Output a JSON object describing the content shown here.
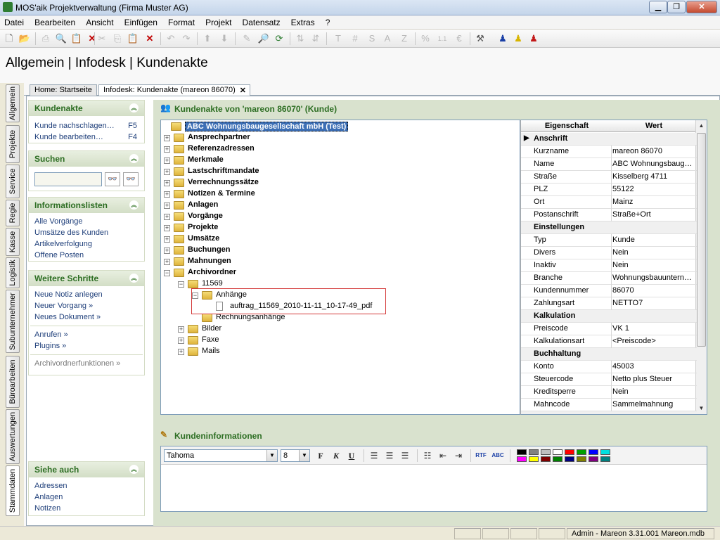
{
  "window": {
    "title": "MOS'aik Projektverwaltung (Firma Muster AG)",
    "btn_min": "▁",
    "btn_max": "❐",
    "btn_close": "✕"
  },
  "menu": [
    "Datei",
    "Bearbeiten",
    "Ansicht",
    "Einfügen",
    "Format",
    "Projekt",
    "Datensatz",
    "Extras",
    "?"
  ],
  "page_title": "Allgemein | Infodesk | Kundenakte",
  "side_tabs": [
    "Allgemein",
    "Projekte",
    "Service",
    "Regie",
    "Kasse",
    "Logistik",
    "Subunternehmer",
    "Büroarbeiten",
    "Auswertungen",
    "Stammdaten"
  ],
  "doc_tabs": [
    "Home: Startseite",
    "Infodesk: Kundenakte (mareon 86070)"
  ],
  "tab_close": "✕",
  "left": {
    "kundenakte": {
      "title": "Kundenakte",
      "links": [
        {
          "label": "Kunde nachschlagen…",
          "key": "F5"
        },
        {
          "label": "Kunde bearbeiten…",
          "key": "F4"
        }
      ]
    },
    "suchen": {
      "title": "Suchen",
      "value": ""
    },
    "infolisten": {
      "title": "Informationslisten",
      "links": [
        "Alle Vorgänge",
        "Umsätze des Kunden",
        "Artikelverfolgung",
        "Offene Posten"
      ]
    },
    "weitere": {
      "title": "Weitere Schritte",
      "links1": [
        "Neue Notiz anlegen",
        "Neuer Vorgang »",
        "Neues Dokument »"
      ],
      "links2": [
        "Anrufen »",
        "Plugins »"
      ],
      "links3": [
        "Archivordnerfunktionen »"
      ]
    },
    "siehe": {
      "title": "Siehe auch",
      "links": [
        "Adressen",
        "Anlagen",
        "Notizen"
      ]
    }
  },
  "kundenakte_header": "Kundenakte von 'mareon 86070' (Kunde)",
  "tree": {
    "root": "ABC Wohnungsbaugesellschaft mbH (Test)",
    "folders": [
      "Ansprechpartner",
      "Referenzadressen",
      "Merkmale",
      "Lastschriftmandate",
      "Verrechnungssätze",
      "Notizen & Termine",
      "Anlagen",
      "Vorgänge",
      "Projekte",
      "Umsätze",
      "Buchungen",
      "Mahnungen",
      "Archivordner"
    ],
    "archiv": {
      "sub": "11569",
      "anhaenge": "Anhänge",
      "file": "auftrag_11569_2010-11-11_10-17-49_pdf",
      "rechnung": "Rechnungsanhänge"
    },
    "others": [
      "Bilder",
      "Faxe",
      "Mails"
    ]
  },
  "grid": {
    "col_prop": "Eigenschaft",
    "col_val": "Wert",
    "rows": [
      {
        "cat": "Anschrift"
      },
      {
        "k": "Kurzname",
        "v": "mareon 86070"
      },
      {
        "k": "Name",
        "v": "ABC Wohnungsbaug…"
      },
      {
        "k": "Straße",
        "v": "Kisselberg 4711"
      },
      {
        "k": "PLZ",
        "v": "55122"
      },
      {
        "k": "Ort",
        "v": "Mainz"
      },
      {
        "k": "Postanschrift",
        "v": "Straße+Ort"
      },
      {
        "cat": "Einstellungen"
      },
      {
        "k": "Typ",
        "v": "Kunde"
      },
      {
        "k": "Divers",
        "v": "Nein"
      },
      {
        "k": "Inaktiv",
        "v": "Nein"
      },
      {
        "k": "Branche",
        "v": "Wohnungsbauuntern…"
      },
      {
        "k": "Kundennummer",
        "v": "86070"
      },
      {
        "k": "Zahlungsart",
        "v": "NETTO7"
      },
      {
        "cat": "Kalkulation"
      },
      {
        "k": "Preiscode",
        "v": "VK 1"
      },
      {
        "k": "Kalkulationsart",
        "v": "<Preiscode>"
      },
      {
        "cat": "Buchhaltung"
      },
      {
        "k": "Konto",
        "v": "45003"
      },
      {
        "k": "Steuercode",
        "v": "Netto plus Steuer"
      },
      {
        "k": "Kreditsperre",
        "v": "Nein"
      },
      {
        "k": "Mahncode",
        "v": "Sammelmahnung"
      }
    ]
  },
  "kundeninfo_header": "Kundeninformationen",
  "editor": {
    "font": "Tahoma",
    "size": "8"
  },
  "status": "Admin - Mareon 3.31.001 Mareon.mdb"
}
